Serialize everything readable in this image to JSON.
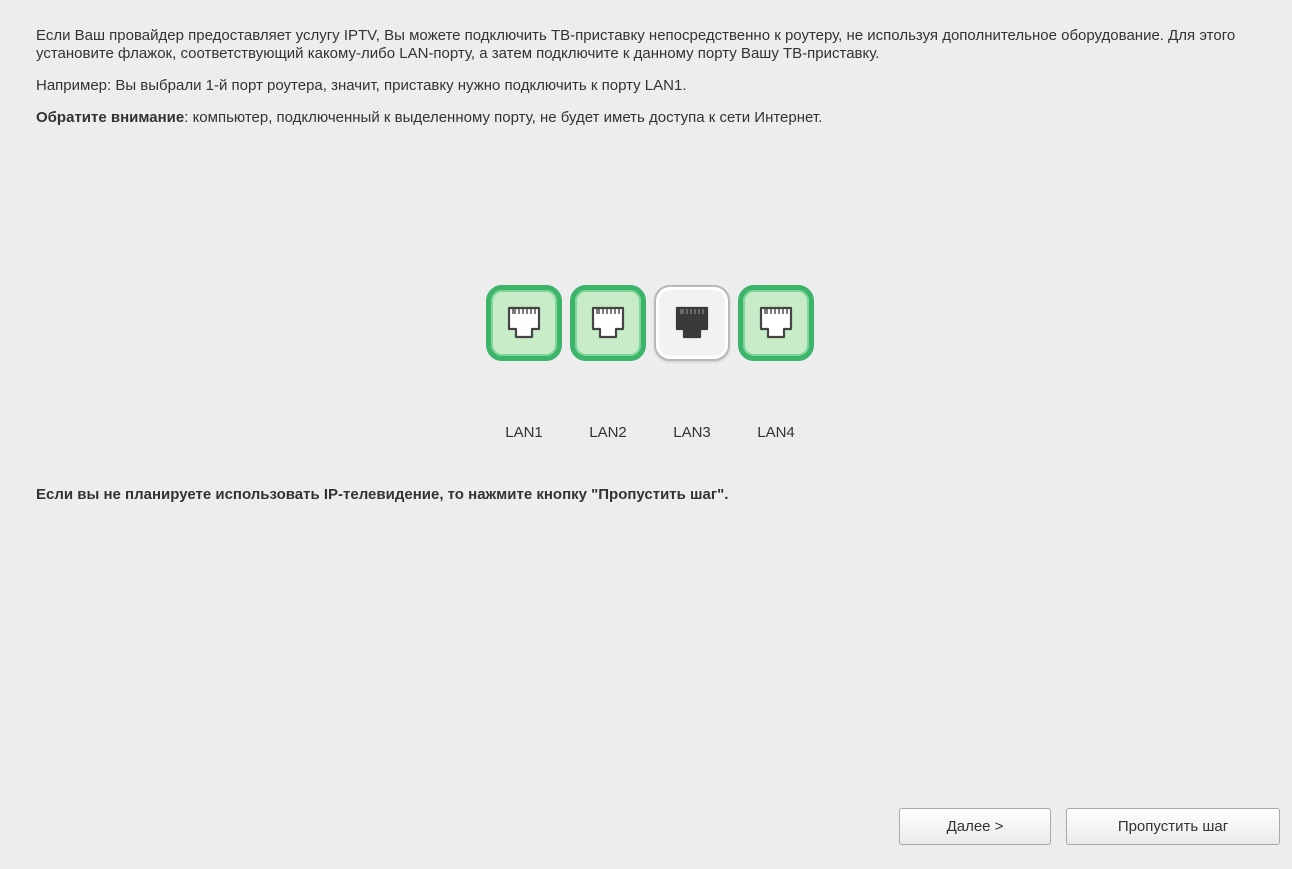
{
  "intro": {
    "text": "Если Ваш провайдер предоставляет услугу IPTV, Вы можете подключить ТВ-приставку непосредственно к роутеру, не используя дополнительное оборудование. Для этого установите флажок, соответствующий какому-либо LAN-порту, а затем подключите к данному порту Вашу ТВ-приставку."
  },
  "example": {
    "text": "Например: Вы выбрали 1-й порт роутера, значит, приставку нужно подключить к порту LAN1."
  },
  "note": {
    "label": "Обратите внимание",
    "text": ": компьютер, подключенный к выделенному порту, не будет иметь доступа к сети Интернет."
  },
  "ports": [
    {
      "label": "LAN1",
      "selected": true,
      "icon": "ethernet-port-icon"
    },
    {
      "label": "LAN2",
      "selected": true,
      "icon": "ethernet-port-icon"
    },
    {
      "label": "LAN3",
      "selected": false,
      "icon": "ethernet-port-icon"
    },
    {
      "label": "LAN4",
      "selected": true,
      "icon": "ethernet-port-icon"
    }
  ],
  "colors": {
    "port_selected_border": "#3cb46a",
    "port_selected_fill": "#c9ecc8",
    "port_unselected_fill": "#f2f2f2",
    "background": "#ededed"
  },
  "skip_note": {
    "text": "Если вы не планируете использовать IP-телевидение, то нажмите кнопку \"Пропустить шаг\"."
  },
  "buttons": {
    "next_label": "Далее >",
    "skip_label": "Пропустить шаг"
  }
}
